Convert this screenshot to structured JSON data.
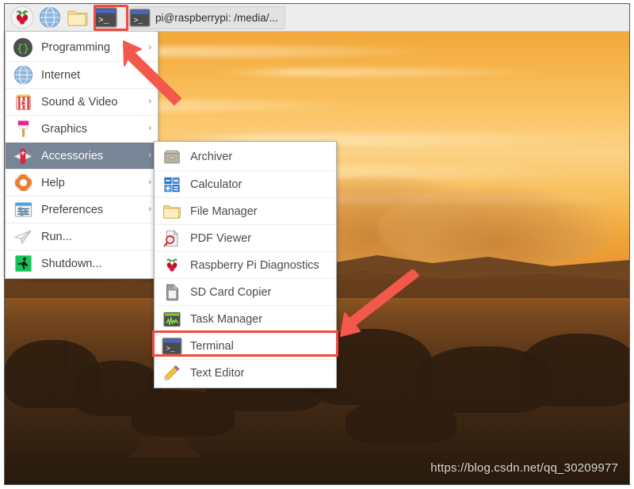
{
  "taskbar": {
    "launchers": [
      {
        "name": "raspberry-menu-icon",
        "label": "Menu"
      },
      {
        "name": "web-browser-icon",
        "label": "Web Browser"
      },
      {
        "name": "file-manager-icon",
        "label": "File Manager"
      },
      {
        "name": "terminal-icon",
        "label": "Terminal"
      }
    ],
    "window": {
      "icon": "terminal-icon",
      "title": "pi@raspberrypi: /media/..."
    }
  },
  "main_menu": {
    "items": [
      {
        "label": "Programming",
        "icon": "programming-icon",
        "has_submenu": true,
        "selected": false
      },
      {
        "label": "Internet",
        "icon": "internet-icon",
        "has_submenu": false,
        "selected": false
      },
      {
        "label": "Sound & Video",
        "icon": "sound-video-icon",
        "has_submenu": true,
        "selected": false
      },
      {
        "label": "Graphics",
        "icon": "graphics-icon",
        "has_submenu": true,
        "selected": false
      },
      {
        "label": "Accessories",
        "icon": "accessories-icon",
        "has_submenu": true,
        "selected": true
      },
      {
        "label": "Help",
        "icon": "help-icon",
        "has_submenu": true,
        "selected": false
      },
      {
        "label": "Preferences",
        "icon": "preferences-icon",
        "has_submenu": true,
        "selected": false
      },
      {
        "label": "Run...",
        "icon": "run-icon",
        "has_submenu": false,
        "selected": false
      },
      {
        "label": "Shutdown...",
        "icon": "shutdown-icon",
        "has_submenu": false,
        "selected": false
      }
    ],
    "submenu_arrow_glyph": "›"
  },
  "submenu": {
    "parent": "Accessories",
    "items": [
      {
        "label": "Archiver",
        "icon": "archiver-icon",
        "highlighted": false
      },
      {
        "label": "Calculator",
        "icon": "calculator-icon",
        "highlighted": false
      },
      {
        "label": "File Manager",
        "icon": "folder-icon",
        "highlighted": false
      },
      {
        "label": "PDF Viewer",
        "icon": "pdf-viewer-icon",
        "highlighted": false
      },
      {
        "label": "Raspberry Pi Diagnostics",
        "icon": "raspberry-pi-icon",
        "highlighted": false
      },
      {
        "label": "SD Card Copier",
        "icon": "sd-card-icon",
        "highlighted": false
      },
      {
        "label": "Task Manager",
        "icon": "task-manager-icon",
        "highlighted": false
      },
      {
        "label": "Terminal",
        "icon": "terminal-icon",
        "highlighted": true
      },
      {
        "label": "Text Editor",
        "icon": "text-editor-icon",
        "highlighted": false
      }
    ]
  },
  "annotations": {
    "highlight_color": "#f04a3f",
    "arrow_top_target": "taskbar terminal launcher",
    "arrow_bottom_target": "Terminal menu item"
  },
  "desktop": {
    "watermark": "https://blog.csdn.net/qq_30209977",
    "wallpaper_description": "Bagan temple silhouette at orange sunset"
  },
  "colors": {
    "accent_red": "#f04a3f",
    "menu_selected": "#778597",
    "panel_bg": "#ffffff",
    "taskbar_bg": "#ededed",
    "sky_orange": "#f0a63a"
  }
}
